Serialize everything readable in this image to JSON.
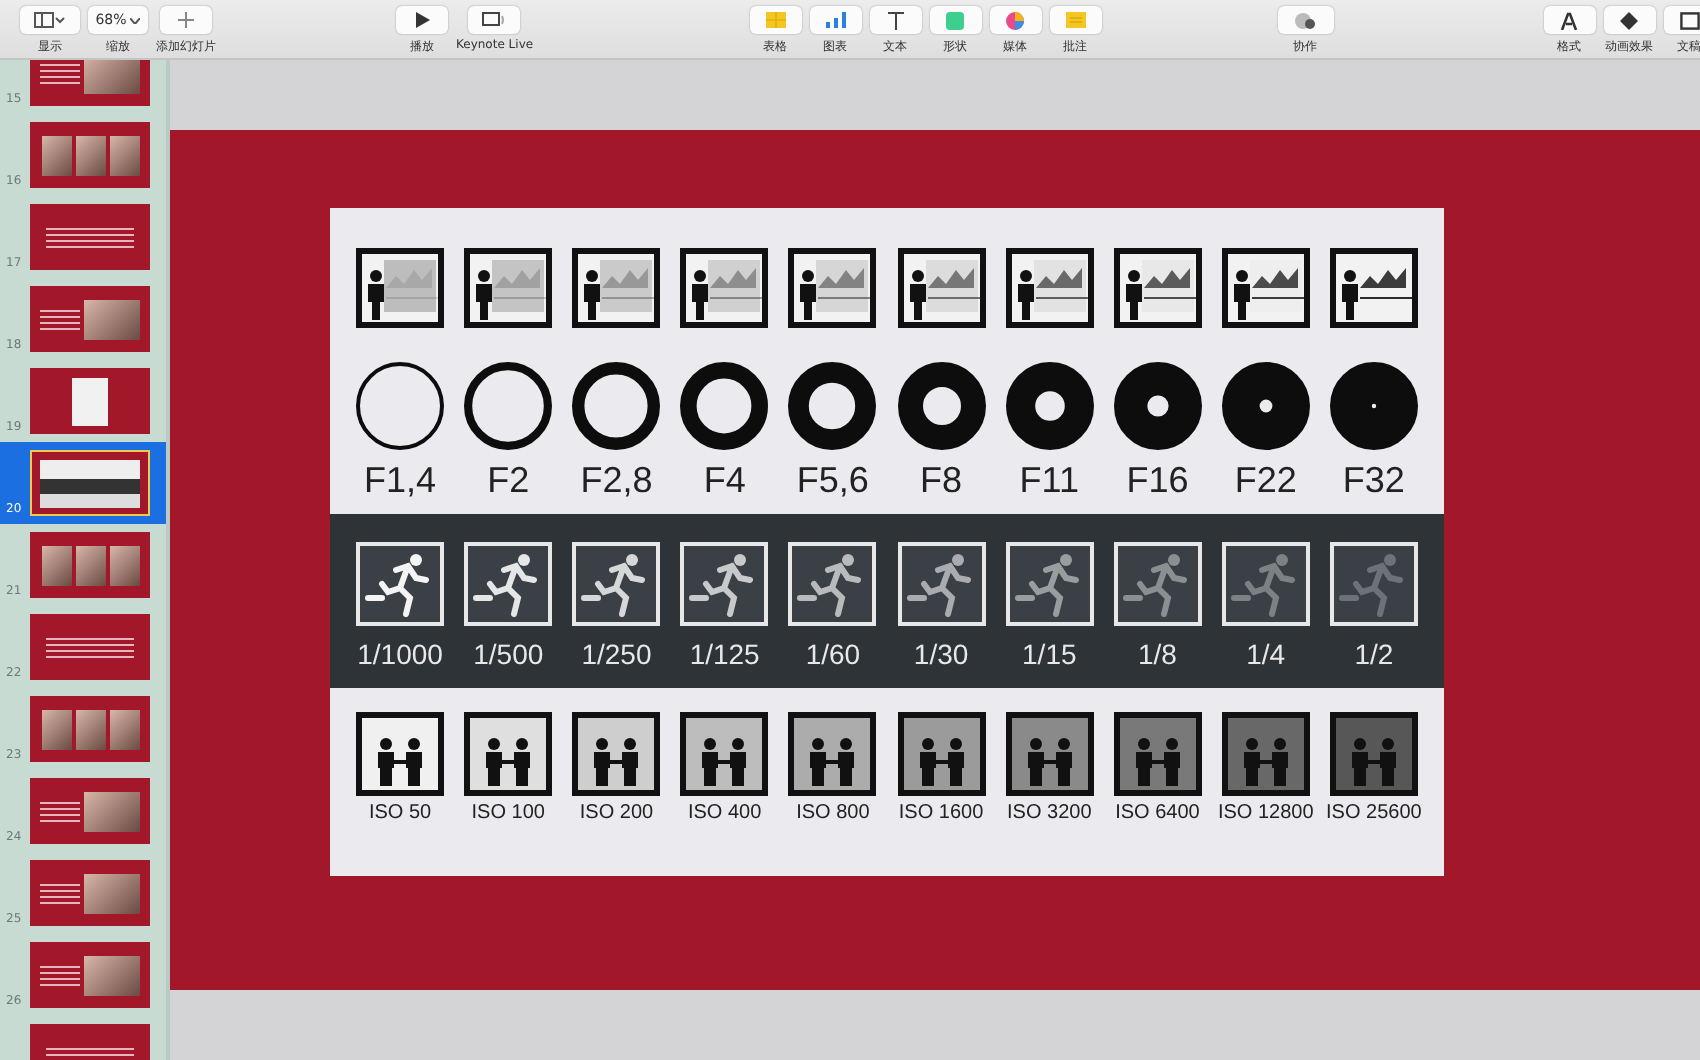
{
  "toolbar": [
    [
      {
        "kind": "view",
        "label": "显示"
      },
      {
        "kind": "zoom",
        "value": "68%",
        "label": "缩放"
      },
      {
        "kind": "add",
        "label": "添加幻灯片"
      }
    ],
    [
      {
        "kind": "play",
        "label": "播放"
      },
      {
        "kind": "live",
        "label": "Keynote Live"
      }
    ],
    [
      {
        "kind": "table",
        "label": "表格"
      },
      {
        "kind": "chart",
        "label": "图表"
      },
      {
        "kind": "text",
        "label": "文本"
      },
      {
        "kind": "shape",
        "label": "形状"
      },
      {
        "kind": "media",
        "label": "媒体"
      },
      {
        "kind": "comment",
        "label": "批注"
      }
    ],
    [
      {
        "kind": "collab",
        "label": "协作"
      }
    ],
    [
      {
        "kind": "format",
        "label": "格式"
      },
      {
        "kind": "animate",
        "label": "动画效果"
      },
      {
        "kind": "document",
        "label": "文稿"
      }
    ]
  ],
  "slides": [
    {
      "number": "15",
      "kind": "photo",
      "selected": false
    },
    {
      "number": "16",
      "kind": "grid",
      "selected": false
    },
    {
      "number": "17",
      "kind": "text",
      "selected": false
    },
    {
      "number": "18",
      "kind": "photo",
      "selected": false
    },
    {
      "number": "19",
      "kind": "diagram",
      "selected": false
    },
    {
      "number": "20",
      "kind": "chart",
      "selected": true
    },
    {
      "number": "21",
      "kind": "grid",
      "selected": false
    },
    {
      "number": "22",
      "kind": "text",
      "selected": false
    },
    {
      "number": "23",
      "kind": "grid",
      "selected": false
    },
    {
      "number": "24",
      "kind": "photo",
      "selected": false
    },
    {
      "number": "25",
      "kind": "photo",
      "selected": false
    },
    {
      "number": "26",
      "kind": "photo",
      "selected": false
    },
    {
      "kind": "text",
      "selected": false
    }
  ],
  "exposure_chart": {
    "columns": [
      {
        "aperture": "F1,4",
        "shutter": "1/1000",
        "iso": "ISO 50"
      },
      {
        "aperture": "F2",
        "shutter": "1/500",
        "iso": "ISO 100"
      },
      {
        "aperture": "F2,8",
        "shutter": "1/250",
        "iso": "ISO 200"
      },
      {
        "aperture": "F4",
        "shutter": "1/125",
        "iso": "ISO 400"
      },
      {
        "aperture": "F5,6",
        "shutter": "1/60",
        "iso": "ISO 800"
      },
      {
        "aperture": "F8",
        "shutter": "1/30",
        "iso": "ISO 1600"
      },
      {
        "aperture": "F11",
        "shutter": "1/15",
        "iso": "ISO 3200"
      },
      {
        "aperture": "F16",
        "shutter": "1/8",
        "iso": "ISO 6400"
      },
      {
        "aperture": "F22",
        "shutter": "1/4",
        "iso": "ISO 12800"
      },
      {
        "aperture": "F32",
        "shutter": "1/2",
        "iso": "ISO 25600"
      }
    ]
  }
}
